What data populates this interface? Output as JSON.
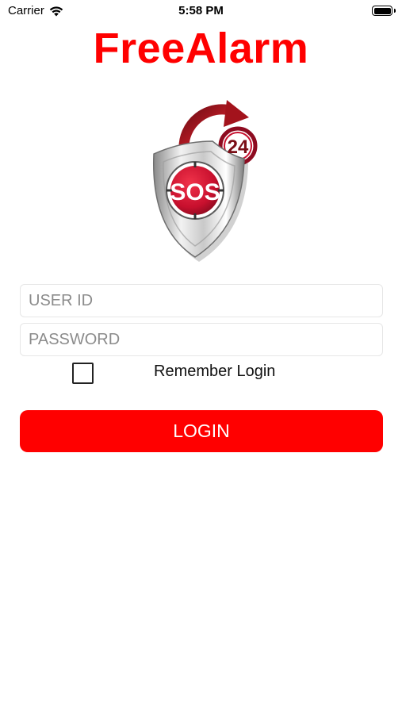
{
  "status_bar": {
    "carrier": "Carrier",
    "time": "5:58 PM",
    "wifi_icon": "wifi-icon",
    "battery_icon": "battery-full-icon",
    "battery_level": 1.0
  },
  "app": {
    "title": "FreeAlarm",
    "title_color": "#ff0000"
  },
  "logo": {
    "icon": "sos-shield-24-logo",
    "badge_text": "24",
    "center_text": "SOS"
  },
  "form": {
    "user_id": {
      "value": "",
      "placeholder": "USER ID"
    },
    "password": {
      "value": "",
      "placeholder": "PASSWORD"
    },
    "remember": {
      "label": "Remember Login",
      "checked": false
    },
    "login_label": "LOGIN",
    "accent_color": "#ff0000"
  }
}
